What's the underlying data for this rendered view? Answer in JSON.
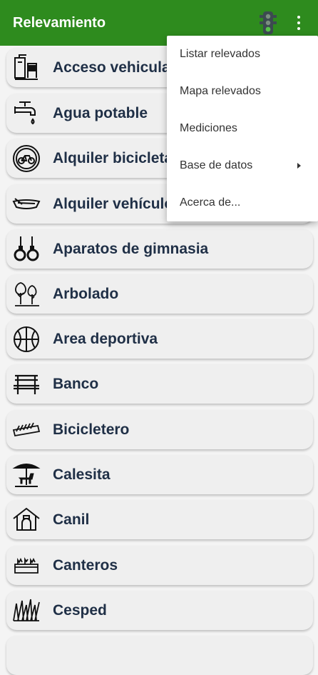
{
  "app": {
    "title": "Relevamiento",
    "accent": "#2e8b1e",
    "actions": [
      {
        "icon": "traffic-light-icon"
      },
      {
        "icon": "more-vert-icon"
      }
    ]
  },
  "list": {
    "items": [
      {
        "label": "Acceso vehicular",
        "icon": "parking-meter-icon"
      },
      {
        "label": "Agua potable",
        "icon": "faucet-icon"
      },
      {
        "label": "Alquiler bicicletas",
        "icon": "bicycle-sign-icon"
      },
      {
        "label": "Alquiler vehículos",
        "icon": "boat-icon"
      },
      {
        "label": "Aparatos de gimnasia",
        "icon": "gym-rings-icon"
      },
      {
        "label": "Arbolado",
        "icon": "trees-icon"
      },
      {
        "label": "Area deportiva",
        "icon": "basketball-icon"
      },
      {
        "label": "Banco",
        "icon": "bench-icon"
      },
      {
        "label": "Bicicletero",
        "icon": "bike-rack-icon"
      },
      {
        "label": "Calesita",
        "icon": "carousel-icon"
      },
      {
        "label": "Canil",
        "icon": "dog-house-icon"
      },
      {
        "label": "Canteros",
        "icon": "planter-icon"
      },
      {
        "label": "Cesped",
        "icon": "grass-icon"
      }
    ]
  },
  "menu": {
    "items": [
      {
        "label": "Listar relevados",
        "submenu": false
      },
      {
        "label": "Mapa relevados",
        "submenu": false
      },
      {
        "label": "Mediciones",
        "submenu": false
      },
      {
        "label": "Base de datos",
        "submenu": true
      },
      {
        "label": "Acerca de...",
        "submenu": false
      }
    ]
  }
}
